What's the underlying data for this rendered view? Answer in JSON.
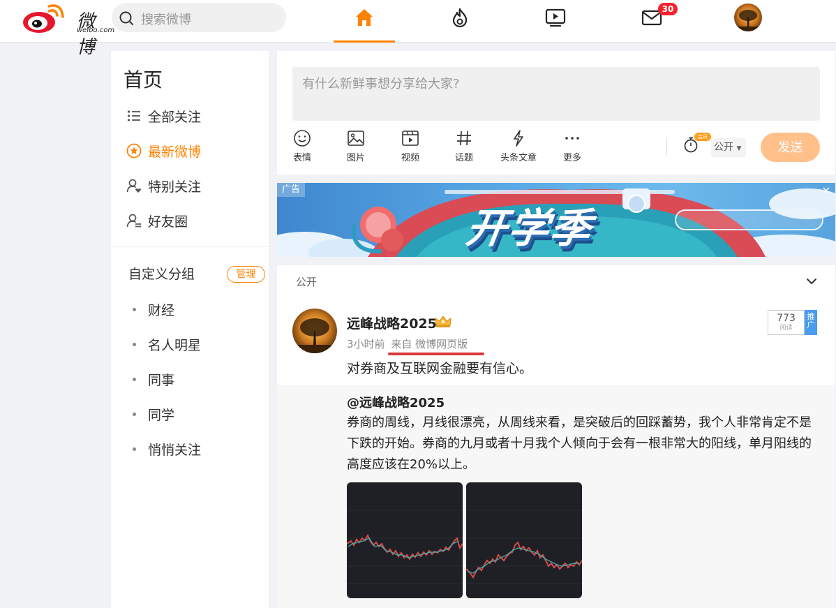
{
  "header": {
    "logo_text": "微博",
    "logo_sub": "weibo.com",
    "search_placeholder": "搜索微博",
    "messages_badge": "30"
  },
  "sidebar": {
    "title": "首页",
    "items": [
      {
        "label": "全部关注",
        "icon": "list-icon"
      },
      {
        "label": "最新微博",
        "icon": "star-circle-icon",
        "active": true
      },
      {
        "label": "特别关注",
        "icon": "user-heart-icon"
      },
      {
        "label": "好友圈",
        "icon": "user-friends-icon"
      }
    ],
    "group_title": "自定义分组",
    "manage_label": "管理",
    "groups": [
      "财经",
      "名人明星",
      "同事",
      "同学",
      "悄悄关注"
    ]
  },
  "composer": {
    "placeholder": "有什么新鲜事想分享给大家?",
    "tools": [
      {
        "label": "表情",
        "icon": "smile-icon"
      },
      {
        "label": "图片",
        "icon": "image-icon"
      },
      {
        "label": "视频",
        "icon": "video-icon"
      },
      {
        "label": "话题",
        "icon": "hashtag-icon"
      },
      {
        "label": "头条文章",
        "icon": "lightning-icon"
      },
      {
        "label": "更多",
        "icon": "more-icon"
      }
    ],
    "vip_tag": "会员",
    "visibility": "公开",
    "send_label": "发送"
  },
  "ad": {
    "tag": "广告",
    "title": "开学季",
    "close": "×"
  },
  "feed": {
    "visibility_header": "公开",
    "post": {
      "author": "远峰战略2025",
      "time": "3小时前",
      "source": "来自 微博网页版",
      "read_count": "773",
      "read_label": "阅读",
      "promote_label": "推广",
      "text": "对券商及互联网金融要有信心。"
    },
    "repost": {
      "author": "@远峰战略2025",
      "text": "券商的周线，月线很漂亮，从周线来看，是突破后的回踩蓄势，我个人非常肯定不是下跌的开始。券商的九月或者十月我个人倾向于会有一根非常大的阳线，单月阳线的高度应该在20%以上。"
    }
  },
  "colors": {
    "accent": "#ff8200",
    "badge": "#f5222d",
    "send_disabled": "#ffc08a",
    "promo": "#4a9cf0"
  }
}
